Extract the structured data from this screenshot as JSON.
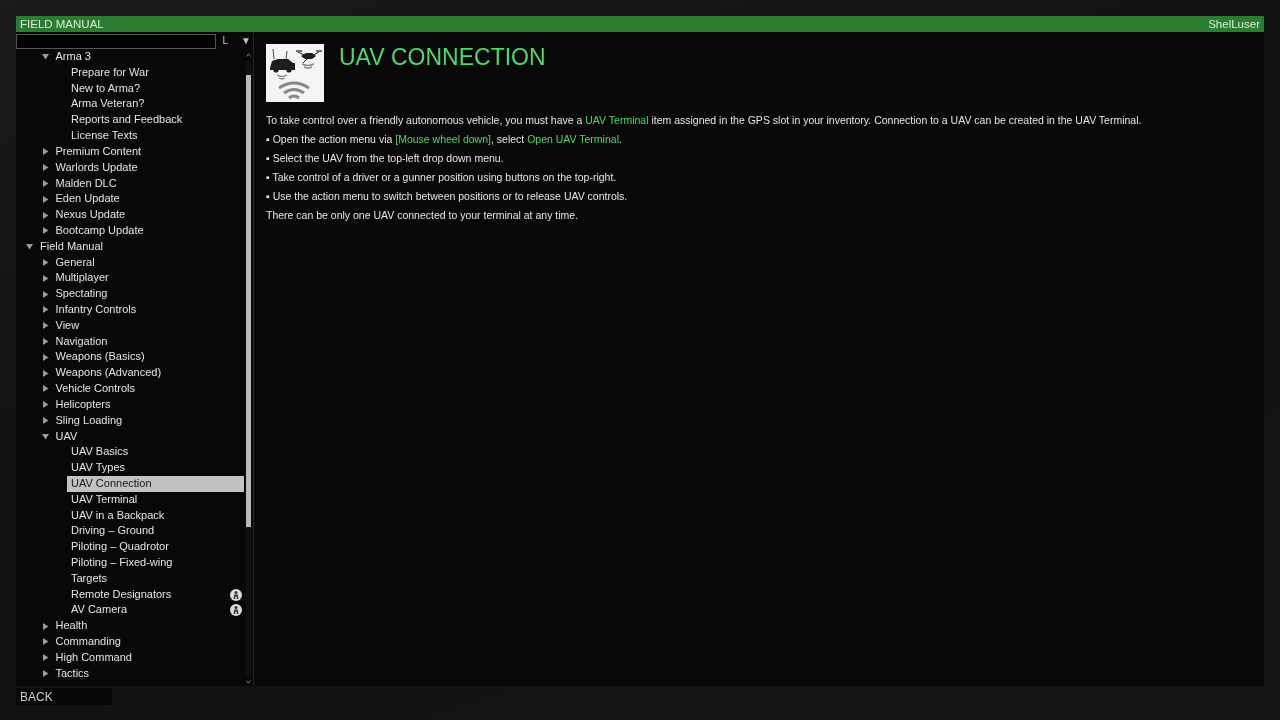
{
  "title_bar": {
    "title": "FIELD MANUAL",
    "user": "ShelLuser"
  },
  "tree_buttons": [
    "L",
    "▼"
  ],
  "tree": [
    {
      "children": [
        {
          "label": "Arma 3",
          "expanded": true,
          "selected": false,
          "children": [
            {
              "label": "Prepare for War",
              "selected": false
            },
            {
              "label": "New to Arma?",
              "selected": false
            },
            {
              "label": "Arma Veteran?",
              "selected": false
            },
            {
              "label": "Reports and Feedback",
              "selected": false
            },
            {
              "label": "License Texts",
              "selected": false
            }
          ]
        },
        {
          "label": "Premium Content",
          "expanded": false,
          "selected": false
        },
        {
          "label": "Warlords Update",
          "expanded": false,
          "selected": false
        },
        {
          "label": "Malden DLC",
          "expanded": false,
          "selected": false
        },
        {
          "label": "Eden Update",
          "expanded": false,
          "selected": false
        },
        {
          "label": "Nexus Update",
          "expanded": false,
          "selected": false
        },
        {
          "label": "Bootcamp Update",
          "expanded": false,
          "selected": false
        }
      ]
    },
    {
      "label": "Field Manual",
      "expanded": true,
      "selected": false,
      "children": [
        {
          "label": "General",
          "expanded": false,
          "selected": false
        },
        {
          "label": "Multiplayer",
          "expanded": false,
          "selected": false
        },
        {
          "label": "Spectating",
          "expanded": false,
          "selected": false
        },
        {
          "label": "Infantry Controls",
          "expanded": false,
          "selected": false
        },
        {
          "label": "View",
          "expanded": false,
          "selected": false
        },
        {
          "label": "Navigation",
          "expanded": false,
          "selected": false
        },
        {
          "label": "Weapons (Basics)",
          "expanded": false,
          "selected": false
        },
        {
          "label": "Weapons (Advanced)",
          "expanded": false,
          "selected": false
        },
        {
          "label": "Vehicle Controls",
          "expanded": false,
          "selected": false
        },
        {
          "label": "Helicopters",
          "expanded": false,
          "selected": false
        },
        {
          "label": "Sling Loading",
          "expanded": false,
          "selected": false
        },
        {
          "label": "UAV",
          "expanded": true,
          "selected": false,
          "children": [
            {
              "label": "UAV Basics",
              "selected": false,
              "dlc": false
            },
            {
              "label": "UAV Types",
              "selected": false,
              "dlc": false
            },
            {
              "label": "UAV Connection",
              "selected": true,
              "dlc": false
            },
            {
              "label": "UAV Terminal",
              "selected": false,
              "dlc": false
            },
            {
              "label": "UAV in a Backpack",
              "selected": false,
              "dlc": false
            },
            {
              "label": "Driving – Ground",
              "selected": false,
              "dlc": false
            },
            {
              "label": "Piloting – Quadrotor",
              "selected": false,
              "dlc": false
            },
            {
              "label": "Piloting – Fixed-wing",
              "selected": false,
              "dlc": false
            },
            {
              "label": "Targets",
              "selected": false,
              "dlc": false
            },
            {
              "label": "Remote Designators",
              "selected": false,
              "dlc": true
            },
            {
              "label": "AV Camera",
              "selected": false,
              "dlc": true
            }
          ]
        },
        {
          "label": "Health",
          "expanded": false,
          "selected": false
        },
        {
          "label": "Commanding",
          "expanded": false,
          "selected": false
        },
        {
          "label": "High Command",
          "expanded": false,
          "selected": false
        },
        {
          "label": "Tactics",
          "expanded": false,
          "selected": false
        }
      ]
    }
  ],
  "article": {
    "title": "UAV CONNECTION",
    "paragraphs": [
      {
        "segments": [
          {
            "text": "To take control over a friendly autonomous vehicle, you must have a ",
            "highlighted": false
          },
          {
            "text": "UAV Terminal",
            "highlighted": true
          },
          {
            "text": " item assigned in the GPS slot in your inventory. Connection to a UAV can be created in the UAV Terminal.",
            "highlighted": false
          }
        ]
      },
      {
        "segments": [
          {
            "text": "▪ Open the action menu via ",
            "highlighted": false
          },
          {
            "text": "[Mouse wheel down]",
            "highlighted": true
          },
          {
            "text": ", select ",
            "highlighted": false
          },
          {
            "text": "Open UAV Terminal",
            "highlighted": true
          },
          {
            "text": ".",
            "highlighted": false
          }
        ]
      },
      {
        "segments": [
          {
            "text": "▪ Select the UAV from the top-left drop down menu.",
            "highlighted": false
          }
        ]
      },
      {
        "segments": [
          {
            "text": "▪ Take control of a driver or a gunner position using buttons on the top-right.",
            "highlighted": false
          }
        ]
      },
      {
        "segments": [
          {
            "text": "▪ Use the action menu to switch between positions or to release UAV controls.",
            "highlighted": false
          }
        ]
      },
      {
        "segments": [
          {
            "text": "There can be only one UAV connected to your terminal at any time.",
            "highlighted": false
          }
        ]
      }
    ]
  },
  "back_button": "BACK"
}
